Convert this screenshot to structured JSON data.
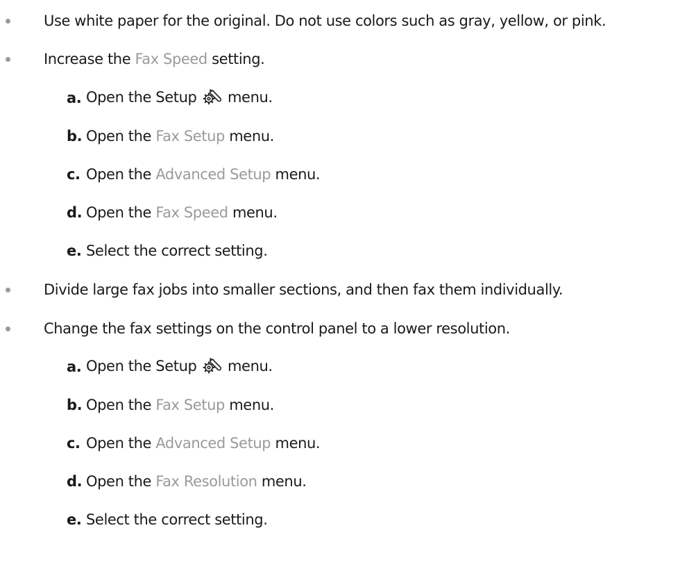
{
  "items": [
    {
      "text": "Use white paper for the original. Do not use colors such as gray, yellow, or pink."
    },
    {
      "before": "Increase the ",
      "ui": "Fax Speed",
      "after": " setting.",
      "steps": [
        {
          "letter": "a.",
          "before": "Open the Setup",
          "icon": "wrench-gear-icon",
          "after": "menu."
        },
        {
          "letter": "b.",
          "before": "Open the ",
          "ui": "Fax Setup",
          "after": " menu."
        },
        {
          "letter": "c.",
          "before": "Open the ",
          "ui": "Advanced Setup",
          "after": " menu."
        },
        {
          "letter": "d.",
          "before": "Open the ",
          "ui": "Fax Speed",
          "after": " menu."
        },
        {
          "letter": "e.",
          "text": "Select the correct setting."
        }
      ]
    },
    {
      "text": "Divide large fax jobs into smaller sections, and then fax them individually."
    },
    {
      "text": "Change the fax settings on the control panel to a lower resolution.",
      "steps": [
        {
          "letter": "a.",
          "before": "Open the Setup",
          "icon": "wrench-gear-icon",
          "after": "menu."
        },
        {
          "letter": "b.",
          "before": "Open the ",
          "ui": "Fax Setup",
          "after": " menu."
        },
        {
          "letter": "c.",
          "before": "Open the ",
          "ui": "Advanced Setup",
          "after": " menu."
        },
        {
          "letter": "d.",
          "before": "Open the ",
          "ui": "Fax Resolution",
          "after": " menu."
        },
        {
          "letter": "e.",
          "text": "Select the correct setting."
        }
      ]
    }
  ],
  "colors": {
    "text": "#1a1a1a",
    "ui_term": "#9a9a9a",
    "bullet": "#9a9a9a"
  }
}
